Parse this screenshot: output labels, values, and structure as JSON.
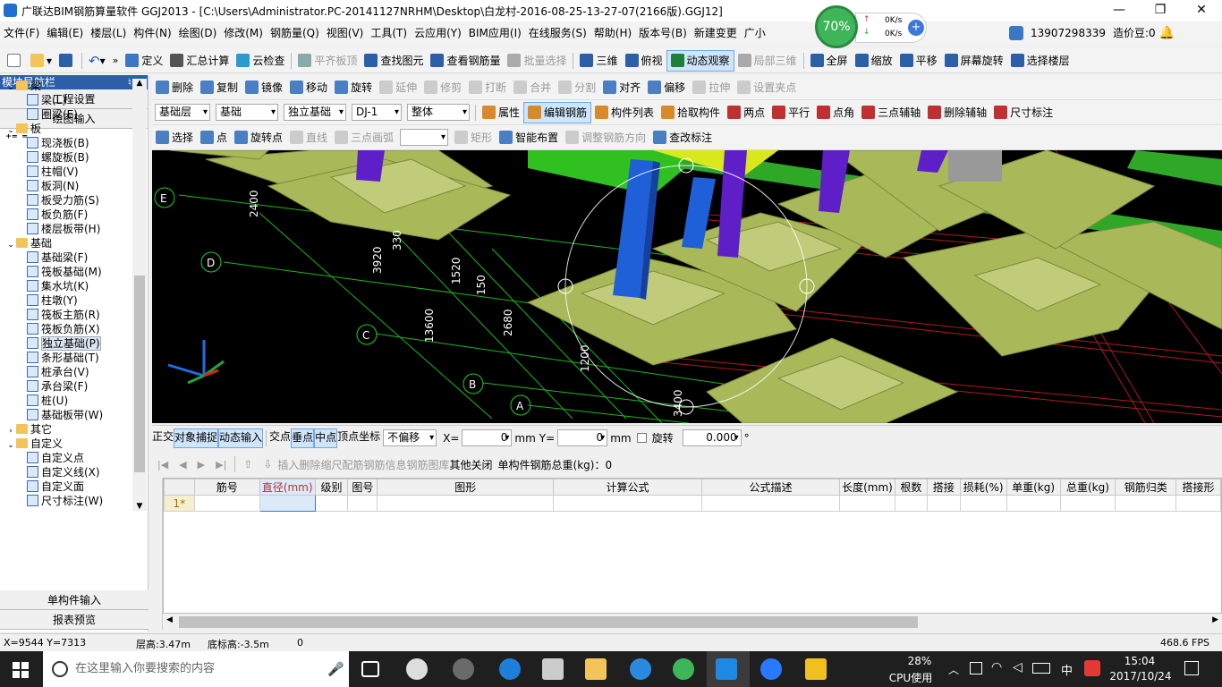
{
  "titlebar": {
    "title": "广联达BIM钢筋算量软件 GGJ2013 - [C:\\Users\\Administrator.PC-20141127NRHM\\Desktop\\白龙村-2016-08-25-13-27-07(2166版).GGJ12]"
  },
  "menu": [
    "文件(F)",
    "编辑(E)",
    "楼层(L)",
    "构件(N)",
    "绘图(D)",
    "修改(M)",
    "钢筋量(Q)",
    "视图(V)",
    "工具(T)",
    "云应用(Y)",
    "BIM应用(I)",
    "在线服务(S)",
    "帮助(H)",
    "版本号(B)",
    "新建变更",
    "广小"
  ],
  "account": {
    "phone": "13907298339",
    "price_label": "造价豆:0"
  },
  "net": {
    "percent": "70%",
    "up": "0K/s",
    "down": "0K/s"
  },
  "toolbar1": [
    "定义",
    "汇总计算",
    "云检查",
    "平齐板顶",
    "查找图元",
    "查看钢筋量",
    "批量选择",
    "三维",
    "俯视",
    "动态观察",
    "局部三维",
    "全屏",
    "缩放",
    "平移",
    "屏幕旋转",
    "选择楼层"
  ],
  "toolbar2": [
    "删除",
    "复制",
    "镜像",
    "移动",
    "旋转",
    "延伸",
    "修剪",
    "打断",
    "合并",
    "分割",
    "对齐",
    "偏移",
    "拉伸",
    "设置夹点"
  ],
  "toolbar3": {
    "combos": [
      "基础层",
      "基础",
      "独立基础",
      "DJ-1",
      "整体"
    ],
    "buttons": [
      "属性",
      "编辑钢筋",
      "构件列表",
      "拾取构件",
      "两点",
      "平行",
      "点角",
      "三点辅轴",
      "删除辅轴",
      "尺寸标注"
    ]
  },
  "toolbar4": [
    "选择",
    "点",
    "旋转点",
    "直线",
    "三点画弧",
    "矩形",
    "智能布置",
    "调整钢筋方向",
    "查改标注"
  ],
  "sidebar": {
    "header": "模块导航栏",
    "pin": "♮ ×",
    "top_buttons": [
      "工程设置",
      "绘图输入"
    ],
    "bottom_buttons": [
      "单构件输入",
      "报表预览"
    ],
    "tree": [
      {
        "t": "group",
        "label": "梁"
      },
      {
        "t": "item",
        "label": "梁(L)"
      },
      {
        "t": "item",
        "label": "圈梁(E)"
      },
      {
        "t": "group",
        "label": "板"
      },
      {
        "t": "item",
        "label": "现浇板(B)"
      },
      {
        "t": "item",
        "label": "螺旋板(B)"
      },
      {
        "t": "item",
        "label": "柱帽(V)"
      },
      {
        "t": "item",
        "label": "板洞(N)"
      },
      {
        "t": "item",
        "label": "板受力筋(S)"
      },
      {
        "t": "item",
        "label": "板负筋(F)"
      },
      {
        "t": "item",
        "label": "楼层板带(H)"
      },
      {
        "t": "group",
        "label": "基础"
      },
      {
        "t": "item",
        "label": "基础梁(F)"
      },
      {
        "t": "item",
        "label": "筏板基础(M)"
      },
      {
        "t": "item",
        "label": "集水坑(K)"
      },
      {
        "t": "item",
        "label": "柱墩(Y)"
      },
      {
        "t": "item",
        "label": "筏板主筋(R)"
      },
      {
        "t": "item",
        "label": "筏板负筋(X)"
      },
      {
        "t": "item",
        "label": "独立基础(P)",
        "sel": true
      },
      {
        "t": "item",
        "label": "条形基础(T)"
      },
      {
        "t": "item",
        "label": "桩承台(V)"
      },
      {
        "t": "item",
        "label": "承台梁(F)"
      },
      {
        "t": "item",
        "label": "桩(U)"
      },
      {
        "t": "item",
        "label": "基础板带(W)"
      },
      {
        "t": "groupc",
        "label": "其它"
      },
      {
        "t": "group",
        "label": "自定义"
      },
      {
        "t": "item",
        "label": "自定义点"
      },
      {
        "t": "item",
        "label": "自定义线(X)"
      },
      {
        "t": "item",
        "label": "自定义面"
      },
      {
        "t": "item",
        "label": "尺寸标注(W)"
      }
    ]
  },
  "viewport": {
    "axes": [
      "E",
      "D",
      "C",
      "B",
      "A"
    ],
    "dims": [
      "2400",
      "3920",
      "330",
      "1520",
      "150",
      "13600",
      "2680",
      "1200",
      "3400"
    ]
  },
  "snapbar": {
    "buttons": [
      "正交",
      "对象捕捉",
      "动态输入",
      "交点",
      "垂点",
      "中点",
      "顶点",
      "坐标"
    ],
    "offset": "不偏移",
    "x_label": "X=",
    "x_val": "0",
    "unit": "mm",
    "y_label": "Y=",
    "y_val": "0",
    "rotate": "旋转",
    "rot_val": "0.000",
    "deg": "°"
  },
  "gridtb": {
    "buttons": [
      "插入",
      "删除",
      "缩尺配筋",
      "钢筋信息",
      "钢筋图库",
      "其他",
      "关闭"
    ],
    "total": "单构件钢筋总重(kg)：0"
  },
  "grid": {
    "columns": [
      "筋号",
      "直径(mm)",
      "级别",
      "图号",
      "图形",
      "计算公式",
      "公式描述",
      "长度(mm)",
      "根数",
      "搭接",
      "损耗(%)",
      "单重(kg)",
      "总重(kg)",
      "钢筋归类",
      "搭接形"
    ],
    "row1": "1*"
  },
  "status": {
    "coords": "X=9544 Y=7313",
    "floor_h": "层高:3.47m",
    "base_h": "底标高:-3.5m",
    "val": "0",
    "fps": "468.6 FPS"
  },
  "taskbar": {
    "search": "在这里输入你要搜索的内容",
    "cpu_pct": "28%",
    "cpu_label": "CPU使用",
    "ime": "中",
    "time": "15:04",
    "date": "2017/10/24"
  }
}
